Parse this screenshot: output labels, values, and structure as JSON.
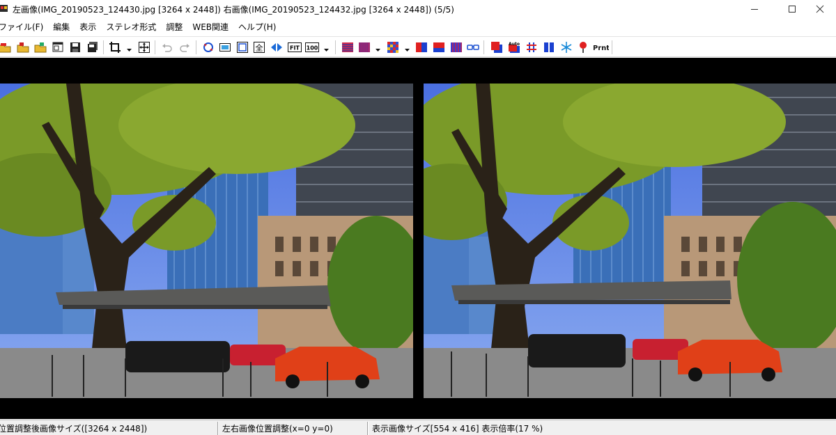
{
  "window": {
    "title": "左画像(IMG_20190523_124430.jpg [3264 x 2448]) 右画像(IMG_20190523_124432.jpg [3264 x 2448])  (5/5)"
  },
  "menu": [
    "ファイル(F)",
    "編集",
    "表示",
    "ステレオ形式",
    "調整",
    "WEB関連",
    "ヘルプ(H)"
  ],
  "toolbar": {
    "fit_label": "FIT",
    "zoom100_label": "100",
    "auto_label": "Auto",
    "print_label": "Prnt",
    "all_label": "全"
  },
  "images": {
    "left": {
      "file": "IMG_20190523_124430.jpg",
      "size": "3264 x 2448"
    },
    "right": {
      "file": "IMG_20190523_124432.jpg",
      "size": "3264 x 2448"
    }
  },
  "status": {
    "pane1": "位置調整後画像サイズ([3264 x 2448])",
    "pane2": "左右画像位置調整(x=0 y=0)",
    "pane3": "表示画像サイズ[554 x 416]  表示倍率(17 %)"
  }
}
